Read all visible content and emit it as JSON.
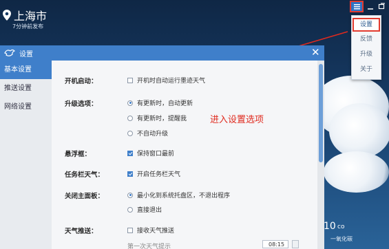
{
  "top": {
    "city": "上海市",
    "published": "7分钟前发布",
    "icons": [
      "location-pin-icon",
      "menu-list-icon",
      "minimize-icon",
      "restore-icon"
    ]
  },
  "menu": {
    "items": [
      {
        "label": "设置",
        "highlighted": true
      },
      {
        "label": "反馈"
      },
      {
        "label": "升级"
      },
      {
        "label": "关于"
      }
    ]
  },
  "dialog": {
    "title": "设置",
    "sidebar": [
      {
        "label": "基本设置",
        "active": true
      },
      {
        "label": "推送设置"
      },
      {
        "label": "网络设置"
      }
    ],
    "rows": {
      "startup": {
        "label": "开机启动：",
        "options": [
          {
            "text": "开机时自动运行墨迹天气",
            "checked": false
          }
        ]
      },
      "upgrade": {
        "label": "升级选项：",
        "options": [
          {
            "text": "有更新时，自动更新",
            "selected": true
          },
          {
            "text": "有更新时，提醒我",
            "selected": false
          },
          {
            "text": "不自动升级",
            "selected": false
          }
        ]
      },
      "float": {
        "label": "悬浮框：",
        "options": [
          {
            "text": "保持窗口最前",
            "checked": true
          }
        ]
      },
      "taskbar": {
        "label": "任务栏天气：",
        "options": [
          {
            "text": "开启任务栏天气",
            "checked": true
          }
        ]
      },
      "close_panel": {
        "label": "关闭主面板：",
        "options": [
          {
            "text": "最小化到系统托盘区，不退出程序",
            "selected": true
          },
          {
            "text": "直接退出",
            "selected": false
          }
        ]
      },
      "push": {
        "label": "天气推送：",
        "options": [
          {
            "text": "接收天气推送",
            "checked": false
          }
        ]
      }
    },
    "partial_row": "第一次天气提示",
    "time_value": "08:15"
  },
  "annotation": "进入设置选项",
  "weather": {
    "temp": "10",
    "unit": "co",
    "sub": "一氧化碳"
  },
  "colors": {
    "accent": "#3f7fca",
    "highlight": "#e23a2e"
  }
}
